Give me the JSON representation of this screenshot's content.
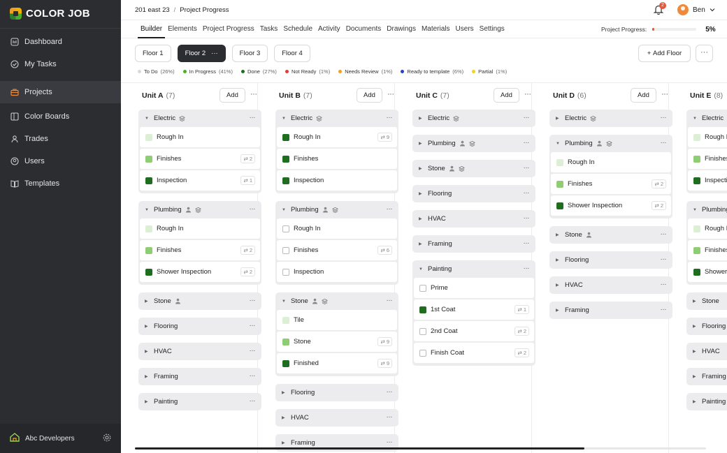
{
  "app": {
    "name": "COLOR JOB"
  },
  "sidebar": {
    "items": [
      {
        "label": "Dashboard",
        "icon": "dashboard-icon"
      },
      {
        "label": "My Tasks",
        "icon": "check-circle-icon"
      },
      {
        "label": "Projects",
        "icon": "briefcase-icon",
        "active": true
      },
      {
        "label": "Color Boards",
        "icon": "board-icon"
      },
      {
        "label": "Trades",
        "icon": "worker-icon"
      },
      {
        "label": "Users",
        "icon": "user-icon"
      },
      {
        "label": "Templates",
        "icon": "book-icon"
      }
    ],
    "company": "Abc Developers"
  },
  "header": {
    "breadcrumb": [
      "201 east 23",
      "Project Progress"
    ],
    "notifications": "2",
    "user": "Ben"
  },
  "tabs": [
    "Builder",
    "Elements",
    "Project Progress",
    "Tasks",
    "Schedule",
    "Activity",
    "Documents",
    "Drawings",
    "Materials",
    "Users",
    "Settings"
  ],
  "active_tab": "Builder",
  "progress": {
    "label": "Project Progress:",
    "value": "5%",
    "fraction": 0.05
  },
  "floors": [
    "Floor 1",
    "Floor 2",
    "Floor 3",
    "Floor 4"
  ],
  "active_floor": "Floor 2",
  "add_floor": "Add Floor",
  "legend": [
    {
      "label": "To Do",
      "pct": "(26%)",
      "color": "#d8d8d8"
    },
    {
      "label": "In Progress",
      "pct": "(41%)",
      "color": "#4caf2a"
    },
    {
      "label": "Done",
      "pct": "(27%)",
      "color": "#1f6e1f"
    },
    {
      "label": "Not Ready",
      "pct": "(1%)",
      "color": "#e23b3b"
    },
    {
      "label": "Needs Review",
      "pct": "(1%)",
      "color": "#f0a020"
    },
    {
      "label": "Ready to template",
      "pct": "(6%)",
      "color": "#2343c9"
    },
    {
      "label": "Partial",
      "pct": "(1%)",
      "color": "#f2d21a"
    }
  ],
  "add_label": "Add",
  "units": [
    {
      "name": "Unit A",
      "count": "(7)",
      "groups": [
        {
          "name": "Electric",
          "open": true,
          "icons": [
            "layers-icon"
          ],
          "tasks": [
            {
              "name": "Rough In",
              "status": "light",
              "badge": ""
            },
            {
              "name": "Finishes",
              "status": "mid",
              "badge": "2"
            },
            {
              "name": "Inspection",
              "status": "dark",
              "badge": "1"
            }
          ]
        },
        {
          "name": "Plumbing",
          "open": true,
          "icons": [
            "person-icon",
            "layers-icon"
          ],
          "tasks": [
            {
              "name": "Rough In",
              "status": "light",
              "badge": ""
            },
            {
              "name": "Finishes",
              "status": "mid",
              "badge": "2"
            },
            {
              "name": "Shower Inspection",
              "status": "dark",
              "badge": "2"
            }
          ]
        },
        {
          "name": "Stone",
          "open": false,
          "icons": [
            "person-icon"
          ],
          "tasks": []
        },
        {
          "name": "Flooring",
          "open": false,
          "icons": [],
          "tasks": []
        },
        {
          "name": "HVAC",
          "open": false,
          "icons": [],
          "tasks": []
        },
        {
          "name": "Framing",
          "open": false,
          "icons": [],
          "tasks": []
        },
        {
          "name": "Painting",
          "open": false,
          "icons": [],
          "tasks": []
        }
      ]
    },
    {
      "name": "Unit B",
      "count": "(7)",
      "groups": [
        {
          "name": "Electric",
          "open": true,
          "icons": [
            "layers-icon"
          ],
          "tasks": [
            {
              "name": "Rough In",
              "status": "dark",
              "badge": "9"
            },
            {
              "name": "Finishes",
              "status": "dark",
              "badge": ""
            },
            {
              "name": "Inspection",
              "status": "dark",
              "badge": ""
            }
          ]
        },
        {
          "name": "Plumbing",
          "open": true,
          "icons": [
            "person-icon",
            "layers-icon"
          ],
          "tasks": [
            {
              "name": "Rough In",
              "status": "empty",
              "badge": ""
            },
            {
              "name": "Finishes",
              "status": "empty",
              "badge": "6"
            },
            {
              "name": "Inspection",
              "status": "empty",
              "badge": ""
            }
          ]
        },
        {
          "name": "Stone",
          "open": true,
          "icons": [
            "person-icon",
            "layers-icon"
          ],
          "tasks": [
            {
              "name": "Tile",
              "status": "light",
              "badge": ""
            },
            {
              "name": "Stone",
              "status": "mid",
              "badge": "9"
            },
            {
              "name": "Finished",
              "status": "dark",
              "badge": "9"
            }
          ]
        },
        {
          "name": "Flooring",
          "open": false,
          "icons": [],
          "tasks": []
        },
        {
          "name": "HVAC",
          "open": false,
          "icons": [],
          "tasks": []
        },
        {
          "name": "Framing",
          "open": false,
          "icons": [],
          "tasks": []
        }
      ]
    },
    {
      "name": "Unit C",
      "count": "(7)",
      "groups": [
        {
          "name": "Electric",
          "open": false,
          "icons": [
            "layers-icon"
          ],
          "tasks": []
        },
        {
          "name": "Plumbing",
          "open": false,
          "icons": [
            "person-icon",
            "layers-icon"
          ],
          "tasks": []
        },
        {
          "name": "Stone",
          "open": false,
          "icons": [
            "person-icon",
            "layers-icon"
          ],
          "tasks": []
        },
        {
          "name": "Flooring",
          "open": false,
          "icons": [],
          "tasks": []
        },
        {
          "name": "HVAC",
          "open": false,
          "icons": [],
          "tasks": []
        },
        {
          "name": "Framing",
          "open": false,
          "icons": [],
          "tasks": []
        },
        {
          "name": "Painting",
          "open": true,
          "icons": [],
          "tasks": [
            {
              "name": "Prime",
              "status": "empty",
              "badge": ""
            },
            {
              "name": "1st Coat",
              "status": "dark",
              "badge": "1"
            },
            {
              "name": "2nd Coat",
              "status": "empty",
              "badge": "2"
            },
            {
              "name": "Finish Coat",
              "status": "empty",
              "badge": "2"
            }
          ]
        }
      ]
    },
    {
      "name": "Unit D",
      "count": "(6)",
      "groups": [
        {
          "name": "Electric",
          "open": false,
          "icons": [
            "layers-icon"
          ],
          "tasks": []
        },
        {
          "name": "Plumbing",
          "open": true,
          "icons": [
            "person-icon",
            "layers-icon"
          ],
          "tasks": [
            {
              "name": "Rough In",
              "status": "light",
              "badge": ""
            },
            {
              "name": "Finishes",
              "status": "mid",
              "badge": "2"
            },
            {
              "name": "Shower Inspection",
              "status": "dark",
              "badge": "2"
            }
          ]
        },
        {
          "name": "Stone",
          "open": false,
          "icons": [
            "person-icon"
          ],
          "tasks": []
        },
        {
          "name": "Flooring",
          "open": false,
          "icons": [],
          "tasks": []
        },
        {
          "name": "HVAC",
          "open": false,
          "icons": [],
          "tasks": []
        },
        {
          "name": "Framing",
          "open": false,
          "icons": [],
          "tasks": []
        }
      ]
    },
    {
      "name": "Unit E",
      "count": "(8)",
      "groups": [
        {
          "name": "Electric",
          "open": true,
          "icons": [],
          "tasks": [
            {
              "name": "Rough In",
              "status": "light",
              "badge": ""
            },
            {
              "name": "Finishes",
              "status": "mid",
              "badge": ""
            },
            {
              "name": "Inspection",
              "status": "dark",
              "badge": ""
            }
          ]
        },
        {
          "name": "Plumbing",
          "open": true,
          "icons": [],
          "tasks": [
            {
              "name": "Rough In",
              "status": "light",
              "badge": ""
            },
            {
              "name": "Finishes",
              "status": "mid",
              "badge": ""
            },
            {
              "name": "Shower Inspection",
              "status": "dark",
              "badge": ""
            }
          ]
        },
        {
          "name": "Stone",
          "open": false,
          "icons": [],
          "tasks": []
        },
        {
          "name": "Flooring",
          "open": false,
          "icons": [],
          "tasks": []
        },
        {
          "name": "HVAC",
          "open": false,
          "icons": [],
          "tasks": []
        },
        {
          "name": "Framing",
          "open": false,
          "icons": [],
          "tasks": []
        },
        {
          "name": "Painting",
          "open": false,
          "icons": [],
          "tasks": []
        }
      ]
    }
  ]
}
